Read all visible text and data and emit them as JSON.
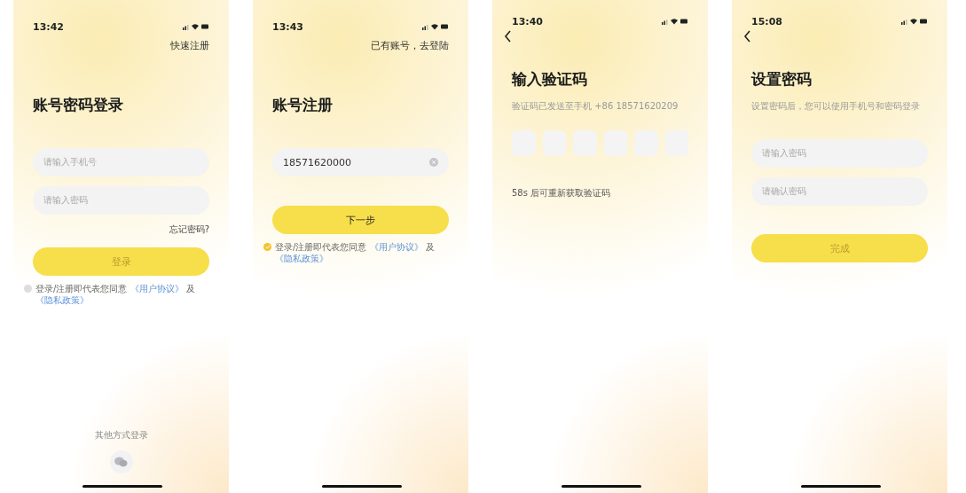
{
  "screens": [
    {
      "time": "13:42",
      "back": false,
      "top_link": "快速注册",
      "title": "账号密码登录",
      "fields": [
        {
          "placeholder": "请输入手机号"
        },
        {
          "placeholder": "请输入密码"
        }
      ],
      "forgot_link": "忘记密码?",
      "button": {
        "label": "登录",
        "disabled": true
      },
      "agreement": {
        "checked": false,
        "text": "登录/注册即代表您同意",
        "link1": "《用户协议》",
        "joiner": "及",
        "link2": "《隐私政策》"
      },
      "other_login": {
        "label": "其他方式登录"
      }
    },
    {
      "time": "13:43",
      "back": false,
      "top_link": "已有账号，去登陆",
      "title": "账号注册",
      "fields": [
        {
          "value": "18571620000",
          "clearable": true
        }
      ],
      "button": {
        "label": "下一步",
        "disabled": false
      },
      "agreement": {
        "checked": true,
        "text": "登录/注册即代表您同意",
        "link1": "《用户协议》",
        "joiner": "及",
        "link2": "《隐私政策》"
      }
    },
    {
      "time": "13:40",
      "back": true,
      "title": "输入验证码",
      "subtitle": "验证码已发送至手机 +86 18571620209",
      "code_boxes": [
        {
          "filled": false
        },
        {
          "filled": false
        },
        {
          "filled": false
        },
        {
          "filled": false
        },
        {
          "filled": false
        },
        {
          "filled": false
        }
      ],
      "resend_hint": "58s 后可重新获取验证码"
    },
    {
      "time": "15:08",
      "back": true,
      "title": "设置密码",
      "subtitle": "设置密码后，您可以使用手机号和密码登录",
      "fields": [
        {
          "placeholder": "请输入密码"
        },
        {
          "placeholder": "请确认密码"
        }
      ],
      "button": {
        "label": "完成",
        "disabled": true
      }
    }
  ]
}
